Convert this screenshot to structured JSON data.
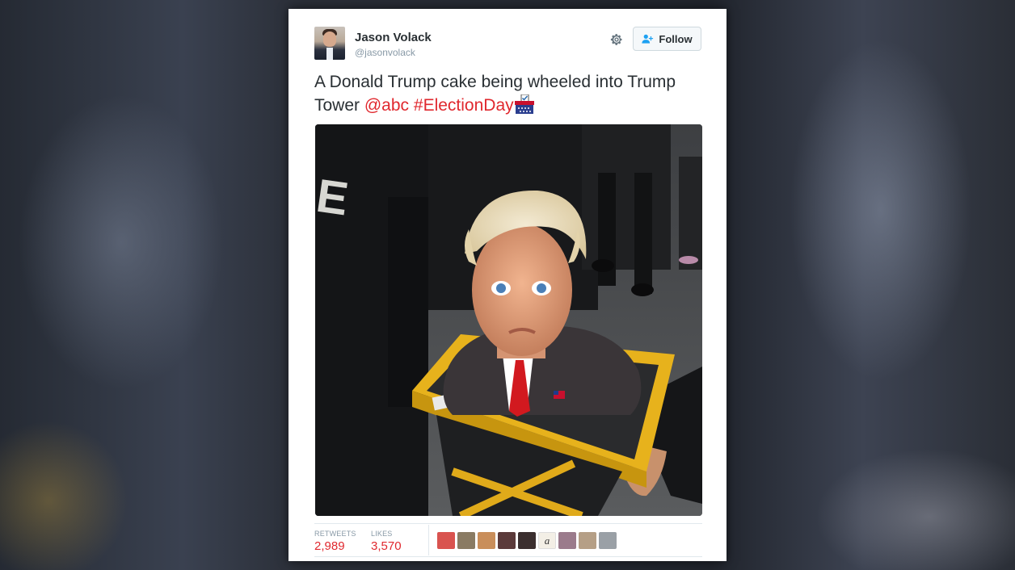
{
  "tweet": {
    "author_name": "Jason Volack",
    "author_handle": "@jasonvolack",
    "follow_label": "Follow",
    "text_plain": "A Donald Trump cake being wheeled into Trump Tower ",
    "mention": "@abc",
    "hashtag": "#ElectionDay",
    "emoji": "ballot-box-emoji"
  },
  "stats": {
    "retweets_label": "RETWEETS",
    "retweets_value": "2,989",
    "likes_label": "LIKES",
    "likes_value": "3,570"
  },
  "likers": [
    {
      "color": "#d9534f"
    },
    {
      "color": "#8a7b63"
    },
    {
      "color": "#c98e5a"
    },
    {
      "color": "#5b3a3a"
    },
    {
      "color": "#3b2f2f"
    },
    {
      "color": "#f3efe6",
      "text": "a"
    },
    {
      "color": "#9b7b8c"
    },
    {
      "color": "#b59f86"
    },
    {
      "color": "#9aa0a6"
    }
  ],
  "colors": {
    "link": "#e0282e",
    "text": "#292f33",
    "muted": "#8899a6"
  },
  "icons": [
    "gear-icon",
    "follow-person-icon",
    "ballot-box-emoji"
  ]
}
